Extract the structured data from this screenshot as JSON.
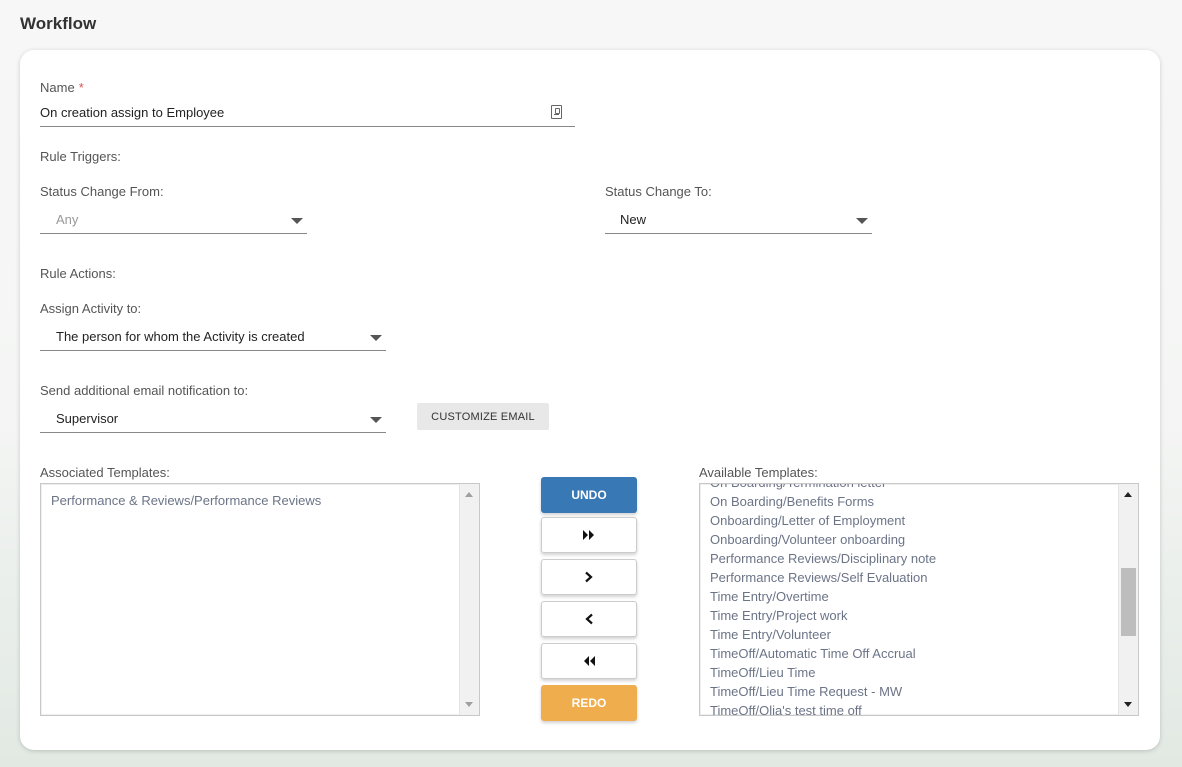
{
  "page": {
    "title": "Workflow"
  },
  "form": {
    "name_label": "Name",
    "required_mark": "*",
    "name_value": "On creation assign to Employee",
    "rule_triggers_label": "Rule Triggers:",
    "status_from_label": "Status Change From:",
    "status_from_value": "Any",
    "status_to_label": "Status Change To:",
    "status_to_value": "New",
    "rule_actions_label": "Rule Actions:",
    "assign_label": "Assign Activity to:",
    "assign_value": "The person for whom the Activity is created",
    "email_label": "Send additional email notification to:",
    "email_value": "Supervisor",
    "customize_email_label": "CUSTOMIZE EMAIL"
  },
  "templates": {
    "associated_label": "Associated Templates:",
    "associated_items": [
      "Performance & Reviews/Performance Reviews"
    ],
    "available_label": "Available Templates:",
    "available_items": [
      "On Boarding/Termination letter",
      "On Boarding/Benefits Forms",
      "Onboarding/Letter of Employment",
      "Onboarding/Volunteer onboarding",
      "Performance Reviews/Disciplinary note",
      "Performance Reviews/Self Evaluation",
      "Time Entry/Overtime",
      "Time Entry/Project work",
      "Time Entry/Volunteer",
      "TimeOff/Automatic Time Off Accrual",
      "TimeOff/Lieu Time",
      "TimeOff/Lieu Time Request - MW",
      "TimeOff/Olia's test time off"
    ]
  },
  "transfer": {
    "undo_label": "UNDO",
    "redo_label": "REDO",
    "move_all_right_icon": "double-chevron-right-icon",
    "move_right_icon": "chevron-right-icon",
    "move_left_icon": "chevron-left-icon",
    "move_all_left_icon": "double-chevron-left-icon"
  },
  "colors": {
    "undo_button": "#3878b4",
    "redo_button": "#f0ad4e",
    "list_text": "#6b7487",
    "required": "#d9534f"
  }
}
